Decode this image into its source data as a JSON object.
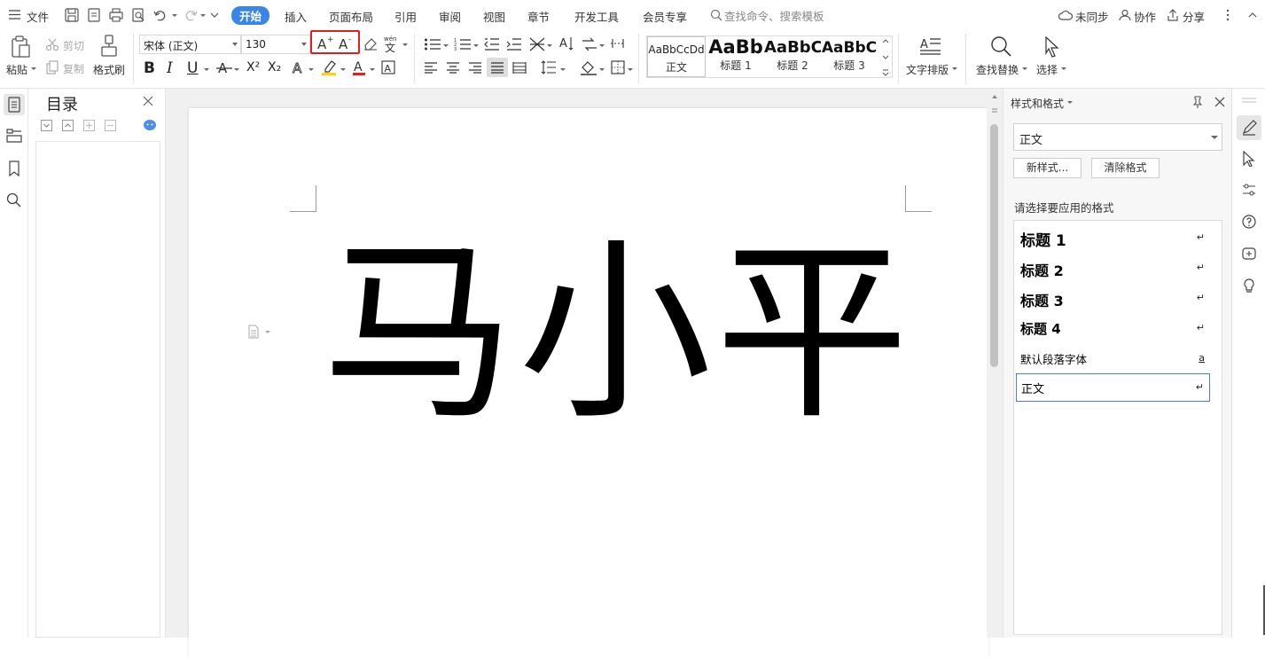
{
  "topbar": {
    "file_menu": "文件",
    "tabs": [
      "开始",
      "插入",
      "页面布局",
      "引用",
      "审阅",
      "视图",
      "章节",
      "开发工具",
      "会员专享"
    ],
    "search_placeholder": "查找命令、搜索模板",
    "sync": "未同步",
    "collab": "协作",
    "share": "分享"
  },
  "ribbon": {
    "paste": "粘贴",
    "cut": "剪切",
    "copy": "复制",
    "format_painter": "格式刷",
    "font_name": "宋体 (正文)",
    "font_size": "130",
    "increase_font_label": "A+",
    "decrease_font_label": "A-",
    "bold": "B",
    "italic": "I",
    "underline": "U",
    "superscript": "X²",
    "subscript": "X₂",
    "styles": [
      {
        "sample": "AaBbCcDd",
        "name": "正文"
      },
      {
        "sample": "AaBb",
        "name": "标题 1"
      },
      {
        "sample": "AaBbC",
        "name": "标题 2"
      },
      {
        "sample": "AaBbC",
        "name": "标题 3"
      }
    ],
    "text_layout": "文字排版",
    "find_replace": "查找替换",
    "select": "选择"
  },
  "toc": {
    "title": "目录"
  },
  "document": {
    "text": "马小平"
  },
  "styles_panel": {
    "title": "样式和格式",
    "current_style": "正文",
    "new_style": "新样式...",
    "clear_format": "清除格式",
    "prompt": "请选择要应用的格式",
    "items": [
      {
        "label": "标题  1",
        "mark": "↵"
      },
      {
        "label": "标题  2",
        "mark": "↵"
      },
      {
        "label": "标题  3",
        "mark": "↵"
      },
      {
        "label": "标题 4",
        "mark": "↵"
      },
      {
        "label": "默认段落字体",
        "mark": "a"
      },
      {
        "label": "正文",
        "mark": "↵"
      }
    ]
  },
  "colors": {
    "accent": "#3a86e8",
    "highlight_box": "#e02020",
    "highlight_yellow": "#ffd400",
    "font_red": "#e02020"
  }
}
